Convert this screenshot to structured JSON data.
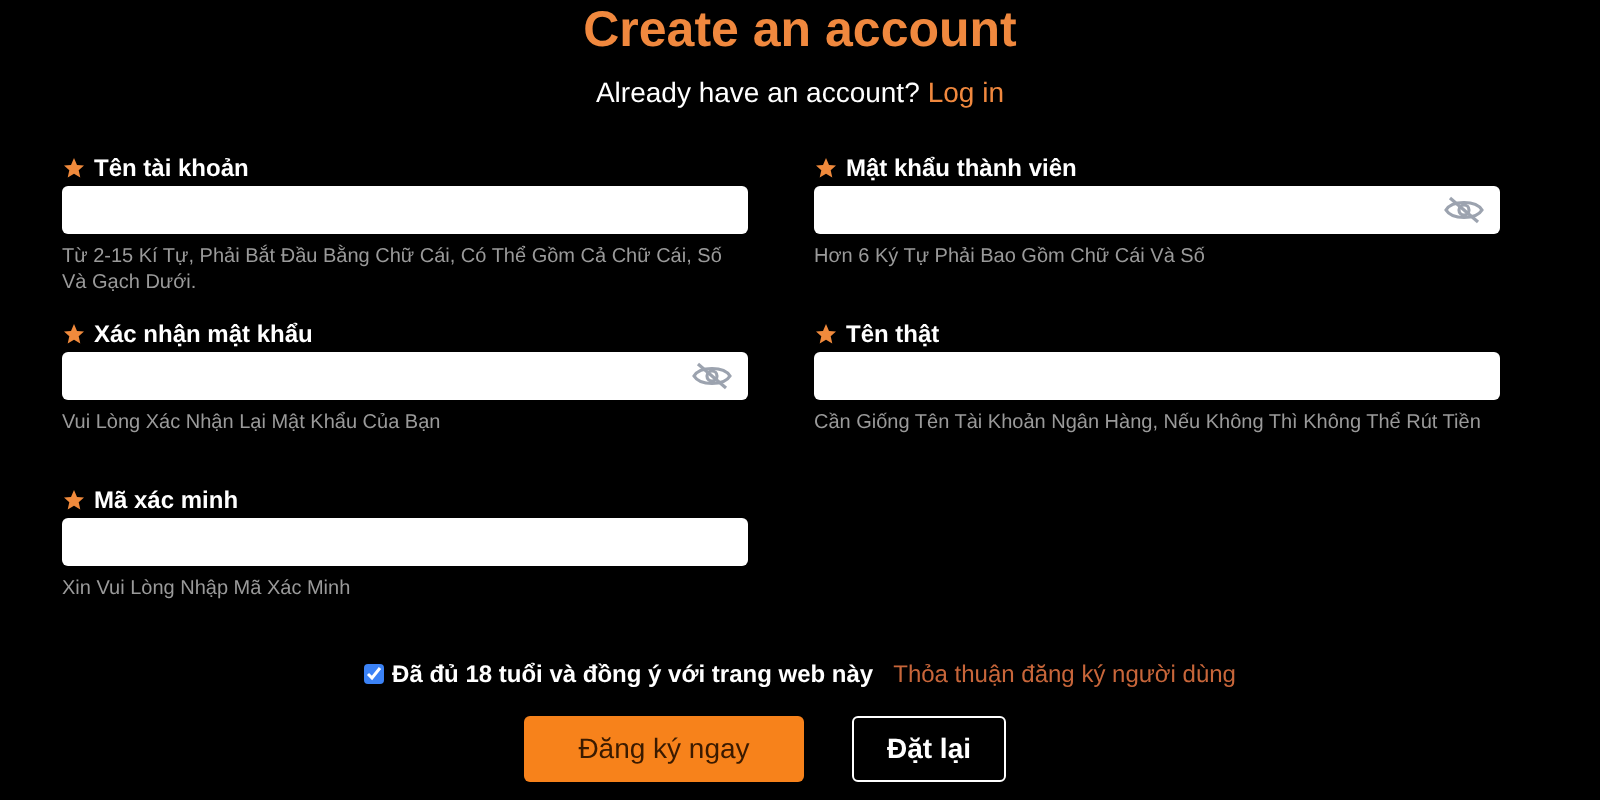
{
  "title": "Create an account",
  "login_prompt": {
    "text": "Already have an account?",
    "link": "Log in"
  },
  "fields": [
    {
      "label": "Tên tài khoản",
      "kind": "text",
      "hint": "Từ 2-15 Kí Tự, Phải Bắt Đầu Bằng Chữ Cái, Có Thể Gồm Cả Chữ Cái, Số Và Gạch Dưới."
    },
    {
      "label": "Mật khẩu thành viên",
      "kind": "password",
      "hint": "Hơn 6 Ký Tự Phải Bao Gồm Chữ Cái Và Số"
    },
    {
      "label": "Xác nhận mật khẩu",
      "kind": "password",
      "hint": "Vui Lòng Xác Nhận Lại Mật Khẩu Của Bạn"
    },
    {
      "label": "Tên thật",
      "kind": "text",
      "hint": "Cần Giống Tên Tài Khoản Ngân Hàng, Nếu Không Thì Không Thể Rút Tiền"
    },
    {
      "label": "Mã xác minh",
      "kind": "text",
      "hint": "Xin Vui Lòng Nhập Mã Xác Minh"
    }
  ],
  "agreement": {
    "checked": true,
    "text": "Đã đủ 18 tuổi và đồng ý với trang web này",
    "link": "Thỏa thuận đăng ký người dùng"
  },
  "buttons": [
    {
      "label": "Đăng ký ngay",
      "kind": "primary"
    },
    {
      "label": "Đặt lại",
      "kind": "outline"
    }
  ]
}
